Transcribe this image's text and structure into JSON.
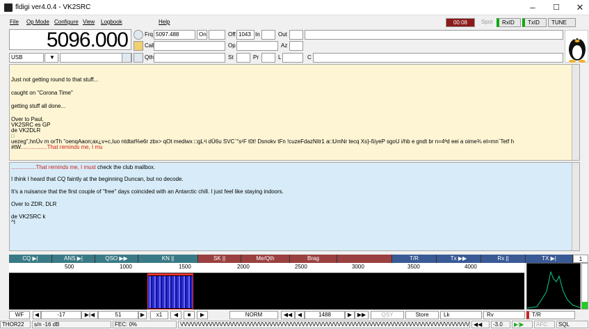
{
  "window": {
    "title": "fldigi ver4.0.4 - VK2SRC",
    "minimize": "–",
    "maximize": "☐",
    "close": "✕"
  },
  "menu": [
    "File",
    "Op Mode",
    "Configure",
    "View",
    "Logbook",
    "Help"
  ],
  "topbar": {
    "timer": "00:08",
    "spot": "Spot",
    "rxid": "RxID",
    "txid": "TxID",
    "tune": "TUNE"
  },
  "freq": {
    "display": "5096.000",
    "mode": "USB"
  },
  "log": {
    "frq_label": "Frq",
    "frq": "5097.488",
    "on_label": "On",
    "off_label": "Off",
    "off": "1043",
    "in_label": "In",
    "out_label": "Out",
    "call_label": "Call",
    "op_label": "Op",
    "az_label": "Az",
    "qth_label": "Qth",
    "st_label": "St",
    "pr_label": "Pr",
    "l_label": "L",
    "c_label": "C"
  },
  "rx_lines": [
    "Just not getting round to that stuff...",
    "caught on \"Corona Time\"",
    "getting stuff all done...",
    "Over to Paul,",
    "VK2SRC es GP",
    "de VK2DLR",
    "□",
    "uezeg\",hnÜv m orTh \"oenqAaon;ax¿v+c,Iuo  ntdtat%e6r zbx> qOt mediwx □gL¹i dÜ6u SVC`°s¹F  t0t! Dsnokv tFn !cuzeFdazNitr1 a□UmNr tecq Xs}-ßiyeP  sgoU i/hb  e gndt br n=4ªd eei a  oime¾  el=mn`Tetf h",
    "#tW"
  ],
  "rx_red": ".................That reminds me, I mu",
  "tx_red": "................That reminds me, I must",
  "tx_lines": [
    " check the club mailbox.",
    "I think I heard that CQ faintly at the beginning Duncan, but no decode.",
    "It's a nuisance that the first couple of \"free\" days coincided with an Antarctic chill. I just feel like staying indoors.",
    "Over to ZDR, DLR",
    "de VK2SRC k",
    "^I"
  ],
  "macros": [
    "CQ ▶|",
    "ANS ▶|",
    "QSO ▶▶",
    "KN ||",
    "SK ||",
    "Me/Qth",
    "Brag",
    "",
    "T/R",
    "Tx ▶▶",
    "Rx ||",
    "TX ▶|"
  ],
  "macro_page": "1",
  "scale": [
    "500",
    "1000",
    "1500",
    "2000",
    "2500",
    "3000",
    "3500",
    "4000"
  ],
  "controls": {
    "wf": "WF",
    "squelch": "-17",
    "range": "51",
    "zoom": "x1",
    "norm": "NORM",
    "carrier": "1488",
    "qsy": "QSY",
    "store": "Store",
    "lk": "Lk",
    "rv": "Rv",
    "tr": "T/R"
  },
  "status": {
    "mode": "THOR22",
    "sn": "s/n -16 dB",
    "fec": "FEC: 0%",
    "ticker": "VVVVVVVVVVVVVVVVVVVVVVVVVVVVVVVVVVVVVVVVVVVVVVVVVVVVVVVVVVVVVVVVVVVVVVVVVVVVVVVVVVVVVV",
    "level": "-3.0",
    "afc": "AFC",
    "sql": "SQL"
  },
  "colors": {
    "macro": "#3a7a86",
    "macro_alt": "#9a4040",
    "rx_bg": "#fdf5d4",
    "tx_bg": "#d7ecf8",
    "timer": "#8b1a1a"
  }
}
